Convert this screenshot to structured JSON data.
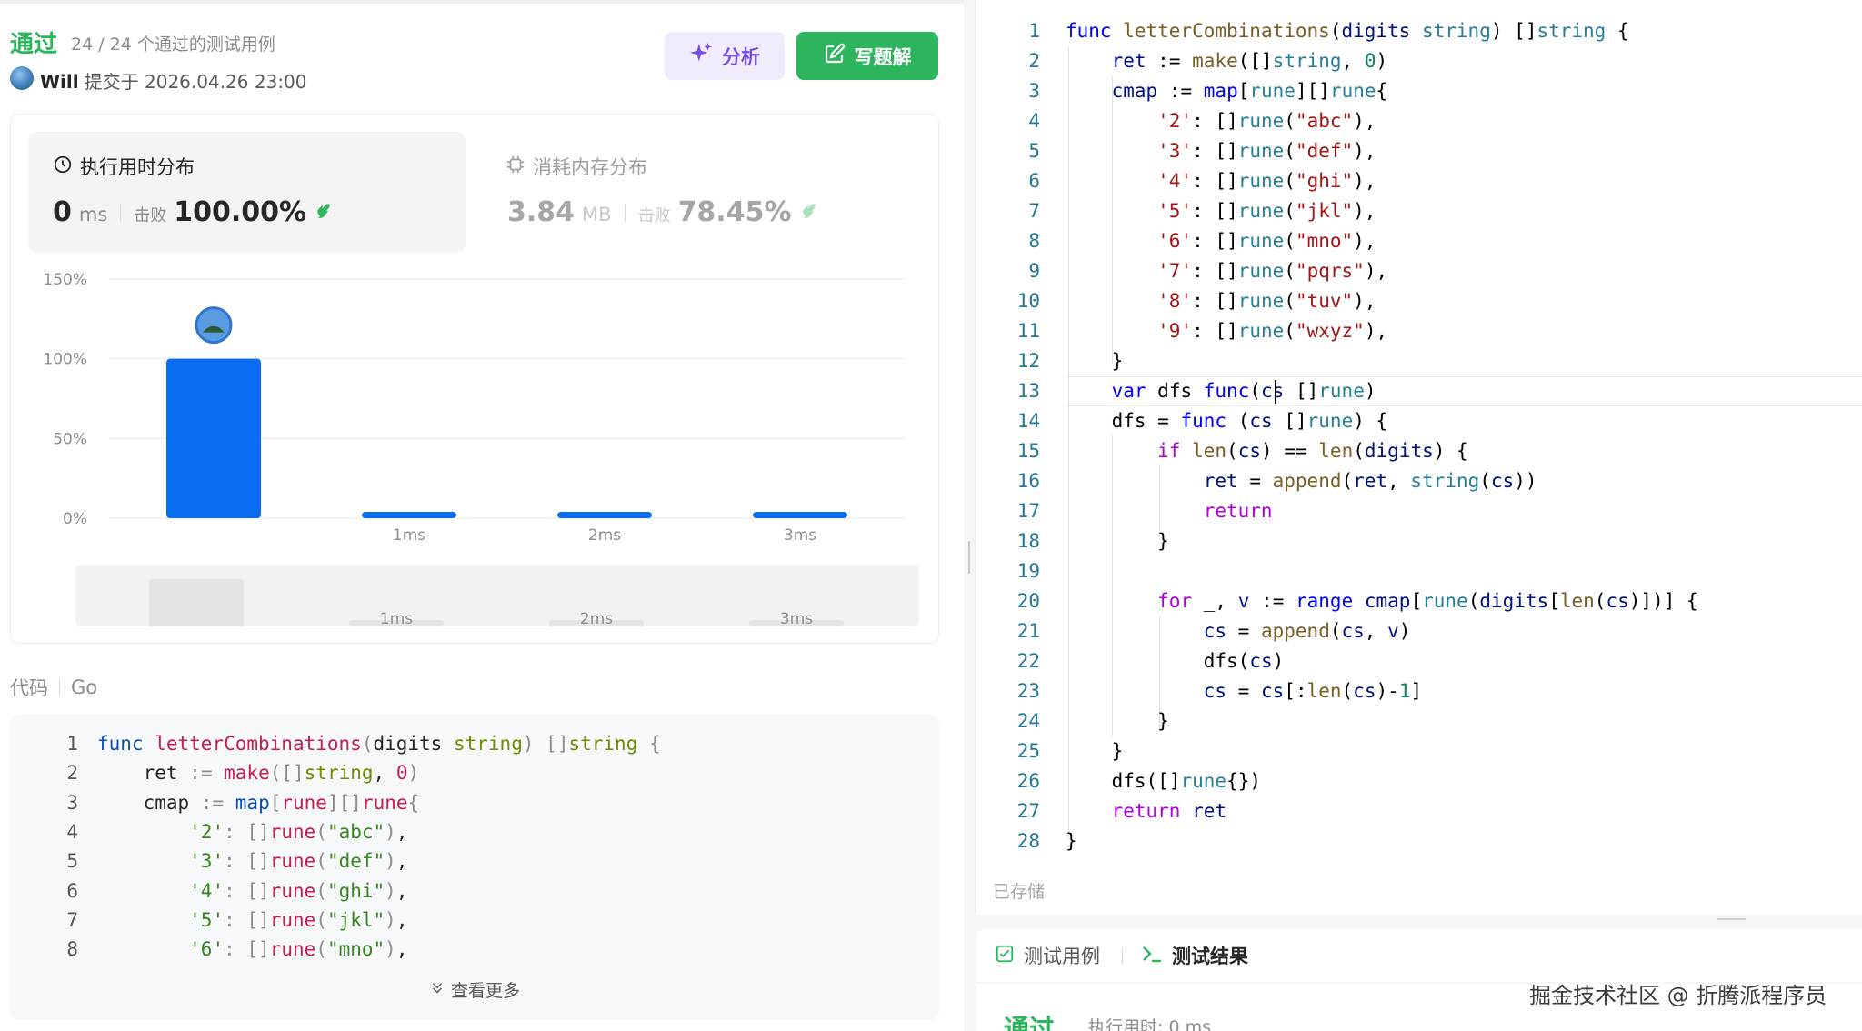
{
  "submission": {
    "status": "通过",
    "count_text": "24 / 24 个通过的测试用例",
    "user": "Will",
    "submitted_text": "提交于 2026.04.26 23:00"
  },
  "buttons": {
    "analyze": "分析",
    "solution": "写题解"
  },
  "stats": {
    "time": {
      "title": "执行用时分布",
      "value": "0",
      "unit": "ms",
      "beats_label": "击败",
      "beats": "100.00%"
    },
    "memory": {
      "title": "消耗内存分布",
      "value": "3.84",
      "unit": "MB",
      "beats_label": "击败",
      "beats": "78.45%"
    }
  },
  "chart_data": {
    "type": "bar",
    "categories": [
      "",
      "1ms",
      "2ms",
      "3ms"
    ],
    "values": [
      100,
      3,
      3,
      3
    ],
    "ylim": [
      0,
      150
    ],
    "yticks": [
      "0%",
      "50%",
      "100%",
      "150%"
    ],
    "highlighted_index": 0,
    "bar_color": "#0a6cf0",
    "grid": true
  },
  "mini_chart": {
    "labels": [
      "",
      "1ms",
      "2ms",
      "3ms"
    ]
  },
  "code_section": {
    "label": "代码",
    "language": "Go",
    "see_more": "查看更多",
    "lines": [
      "func letterCombinations(digits string) []string {",
      "    ret := make([]string, 0)",
      "    cmap := map[rune][]rune{",
      "        '2': []rune(\"abc\"),",
      "        '3': []rune(\"def\"),",
      "        '4': []rune(\"ghi\"),",
      "        '5': []rune(\"jkl\"),",
      "        '6': []rune(\"mno\"),"
    ]
  },
  "editor": {
    "saved_text": "已存储",
    "lines": [
      "func letterCombinations(digits string) []string {",
      "    ret := make([]string, 0)",
      "    cmap := map[rune][]rune{",
      "        '2': []rune(\"abc\"),",
      "        '3': []rune(\"def\"),",
      "        '4': []rune(\"ghi\"),",
      "        '5': []rune(\"jkl\"),",
      "        '6': []rune(\"mno\"),",
      "        '7': []rune(\"pqrs\"),",
      "        '8': []rune(\"tuv\"),",
      "        '9': []rune(\"wxyz\"),",
      "    }",
      "    var dfs func(cs []rune)",
      "    dfs = func (cs []rune) {",
      "        if len(cs) == len(digits) {",
      "            ret = append(ret, string(cs))",
      "            return",
      "        }",
      "",
      "        for _, v := range cmap[rune(digits[len(cs)])] {",
      "            cs = append(cs, v)",
      "            dfs(cs)",
      "            cs = cs[:len(cs)-1]",
      "        }",
      "    }",
      "    dfs([]rune{})",
      "    return ret",
      "}"
    ]
  },
  "bottom": {
    "tab_testcase": "测试用例",
    "tab_result": "测试结果",
    "result_status": "通过",
    "result_time": "执行用时: 0 ms"
  },
  "watermark": "掘金技术社区 @ 折腾派程序员",
  "colors": {
    "accent_green": "#2db55d",
    "bar_blue": "#0a6cf0",
    "analyze_purple": "#7a4fe0"
  }
}
